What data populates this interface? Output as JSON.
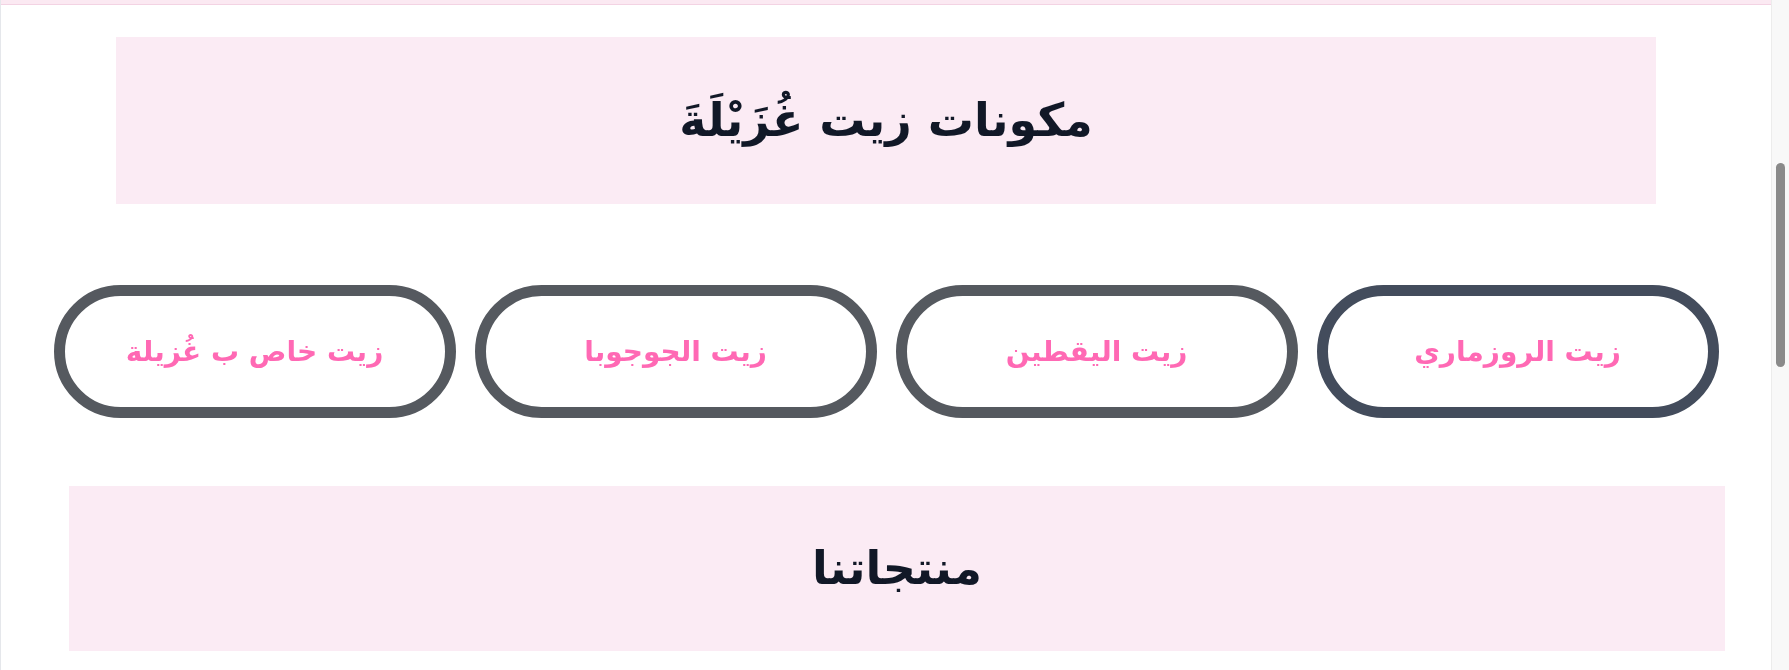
{
  "ingredients_banner": {
    "title": "مكونات زيت غُزَيْلَةَ"
  },
  "ingredient_buttons": [
    {
      "label": "زيت الروزماري",
      "highlighted": true
    },
    {
      "label": "زيت اليقطين",
      "highlighted": false
    },
    {
      "label": "زيت الجوجوبا",
      "highlighted": false
    },
    {
      "label": "زيت خاص ب غُزيلة",
      "highlighted": false
    }
  ],
  "products_banner": {
    "title": "منتجاتنا"
  }
}
